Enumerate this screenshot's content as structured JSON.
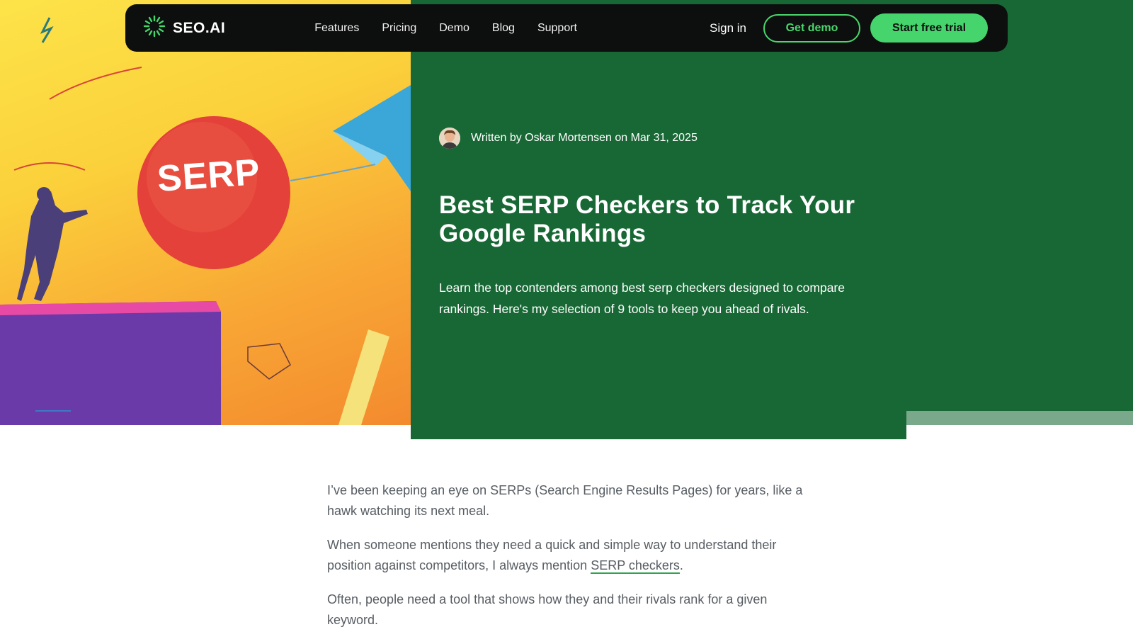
{
  "nav": {
    "logo_text": "SEO.AI",
    "links": [
      "Features",
      "Pricing",
      "Demo",
      "Blog",
      "Support"
    ],
    "sign_in": "Sign in",
    "get_demo": "Get demo",
    "start_trial": "Start free trial"
  },
  "hero": {
    "image_text": "SERP",
    "byline": "Written by Oskar Mortensen on Mar 31, 2025",
    "title": "Best SERP Checkers to Track Your Google Rankings",
    "subtitle": "Learn the top contenders among best serp checkers designed to compare rankings. Here's my selection of 9 tools to keep you ahead of rivals."
  },
  "article": {
    "p1": "I’ve been keeping an eye on SERPs (Search Engine Results Pages) for years, like a hawk watching its next meal.",
    "p2_before": "When someone mentions they need a quick and simple way to understand their position against competitors, I always mention ",
    "p2_link": "SERP checkers",
    "p2_after": ".",
    "p3": "Often, people need a tool that shows how they and their rivals rank for a given keyword."
  },
  "colors": {
    "hero_green": "#186835",
    "accent_green": "#46d46d",
    "navbar_bg": "#0c0f0d",
    "body_text": "#575d63"
  }
}
